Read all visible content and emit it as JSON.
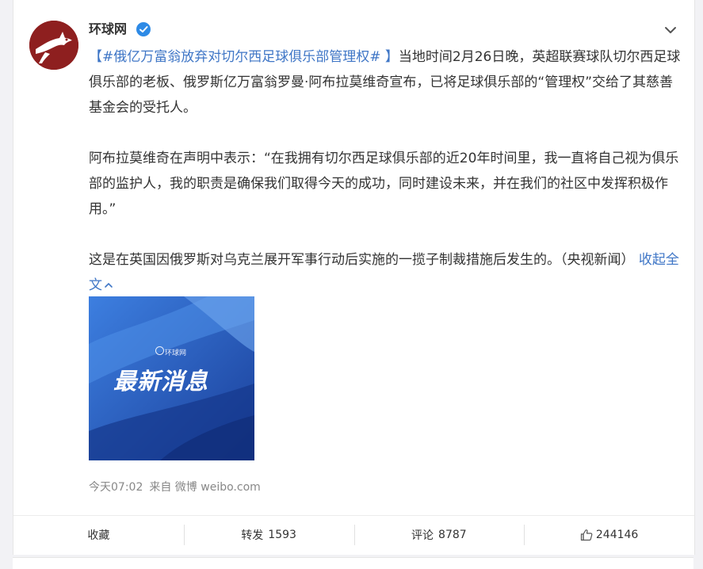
{
  "author": {
    "name": "环球网",
    "avatar_icon": "globe-dog-logo-icon",
    "verified_icon": "verified-check-icon",
    "brand_color": "#8e1f1f"
  },
  "menu_icon": "chevron-down-icon",
  "post": {
    "hashtag": "【#俄亿万富翁放弃对切尔西足球俱乐部管理权# 】",
    "para1_rest": "当地时间2月26日晚，英超联赛球队切尔西足球俱乐部的老板、俄罗斯亿万富翁罗曼·阿布拉莫维奇宣布，已将足球俱乐部的“管理权”交给了其慈善基金会的受托人。",
    "para2": "阿布拉莫维奇在声明中表示：“在我拥有切尔西足球俱乐部的近20年时间里，我一直将自己视为俱乐部的监护人，我的职责是确保我们取得今天的成功，同时建设未来，并在我们的社区中发挥积极作用。”",
    "para3": "这是在英国因俄罗斯对乌克兰展开军事行动后实施的一揽子制裁措施后发生的。（央视新闻）",
    "collapse_label": "收起全文"
  },
  "image": {
    "brand_text": "环球网",
    "title_text": "最新消息"
  },
  "meta": {
    "time": "今天07:02",
    "source": "来自 微博 weibo.com"
  },
  "actions": {
    "favorite_label": "收藏",
    "repost_label": "转发",
    "repost_count": "1593",
    "comment_label": "评论",
    "comment_count": "8787",
    "like_count": "244146",
    "like_icon": "thumbs-up-icon"
  },
  "colors": {
    "link": "#3f76c6",
    "verified": "#2d8ae6",
    "image_blue": "#1f55b8"
  }
}
